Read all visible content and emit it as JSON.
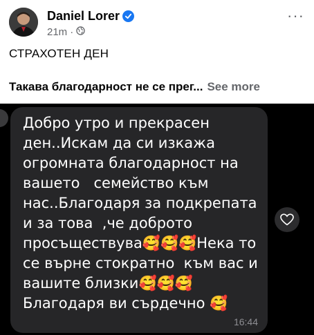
{
  "post": {
    "author": "Daniel Lorer",
    "time": "21m",
    "dot": "·",
    "more": "···",
    "title": "СТРАХОТЕН ДЕН",
    "text": "Такава благодарност не се прег...",
    "see_more": "See more"
  },
  "screenshot": {
    "message": "Добро утро и прекрасен ден..Искам да си изкажа огромната благодарност на вашето   семейство към нас..Благодаря за подкрепата и за това  ,че доброто просъществува🥰🥰🥰Нека то се върне стократно  към вас и  вашите близки🥰🥰🥰 Благодаря ви сърдечно 🥰",
    "time": "16:44"
  },
  "colors": {
    "verified_blue": "#1877f2",
    "bubble": "#262628"
  }
}
